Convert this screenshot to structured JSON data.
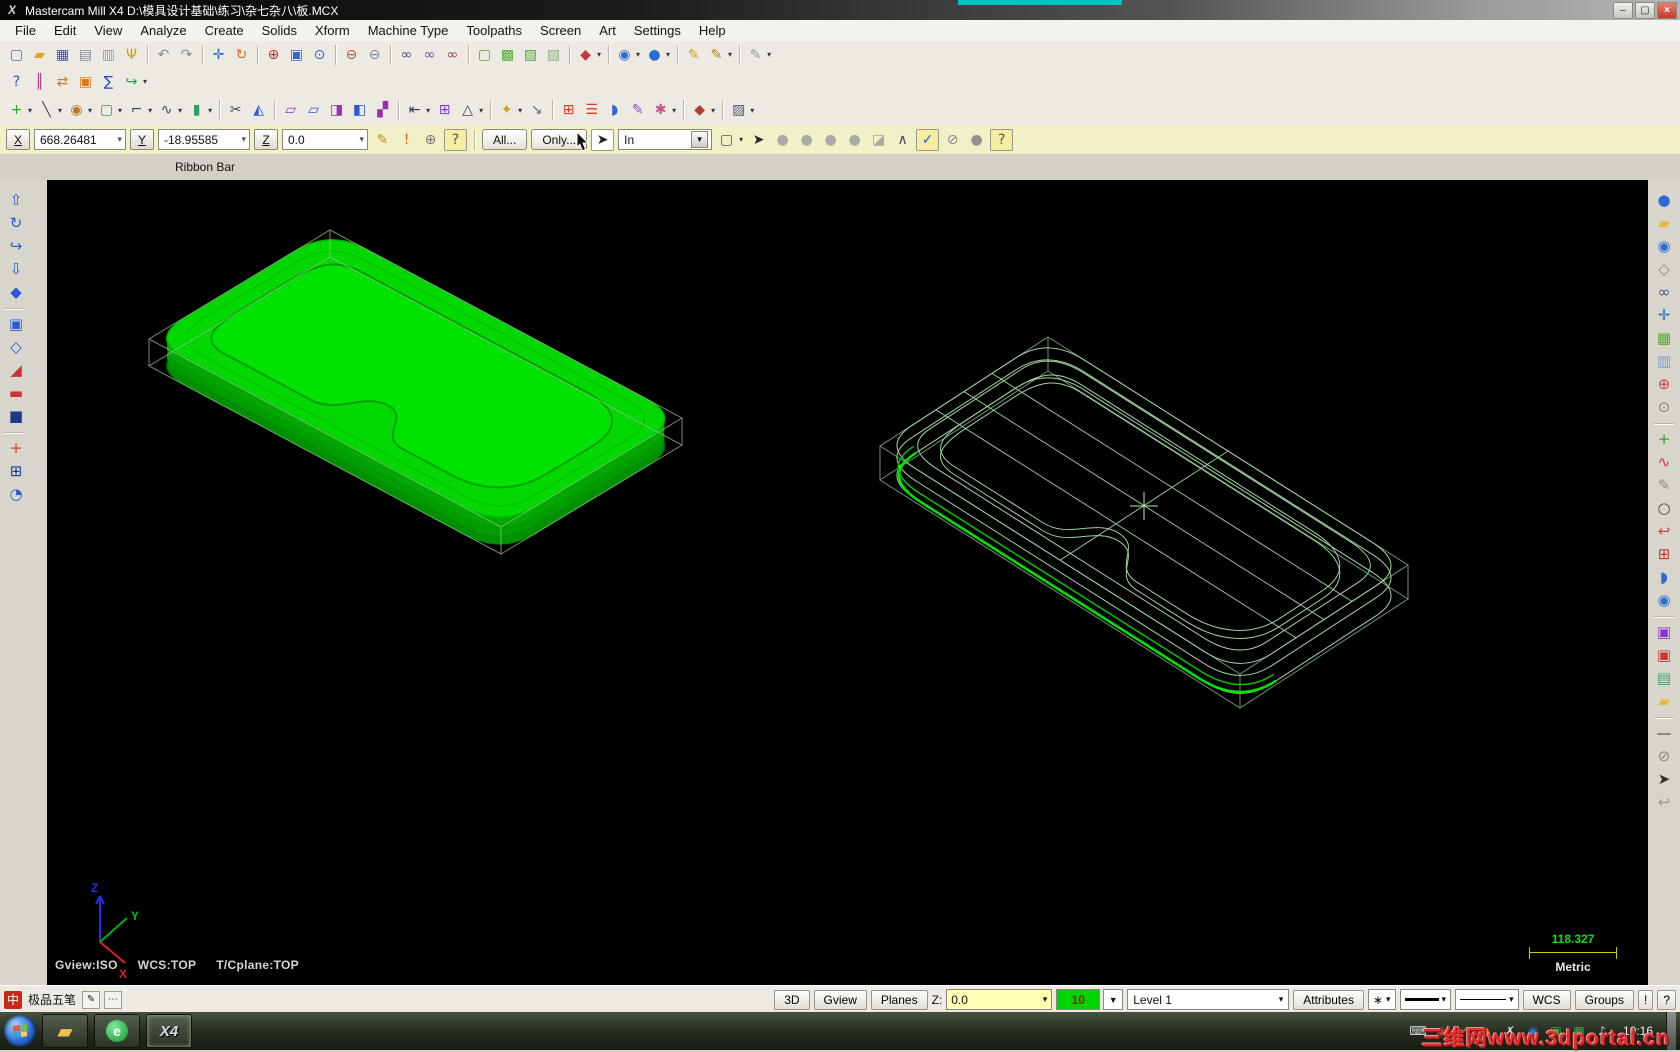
{
  "title_bar": {
    "app_icon_glyph": "X",
    "app_title": "Mastercam Mill X4  D:\\模具设计基础\\练习\\杂七杂八\\板.MCX",
    "minimize_glyph": "–",
    "restore_glyph": "▢",
    "close_glyph": "×"
  },
  "menu_bar": {
    "items": [
      {
        "label": "File"
      },
      {
        "label": "Edit"
      },
      {
        "label": "View"
      },
      {
        "label": "Analyze"
      },
      {
        "label": "Create"
      },
      {
        "label": "Solids"
      },
      {
        "label": "Xform"
      },
      {
        "label": "Machine Type"
      },
      {
        "label": "Toolpaths"
      },
      {
        "label": "Screen"
      },
      {
        "label": "Art"
      },
      {
        "label": "Settings"
      },
      {
        "label": "Help"
      }
    ]
  },
  "toolbar_row1": [
    {
      "n": "new-file",
      "g": "▢",
      "c": "#4a71c8"
    },
    {
      "n": "open-file",
      "g": "▰",
      "c": "#dca62e"
    },
    {
      "n": "save-file",
      "g": "▦",
      "c": "#2f55c0"
    },
    {
      "n": "print",
      "g": "▤",
      "c": "#8a8f9a"
    },
    {
      "n": "file-properties",
      "g": "▥",
      "c": "#7f9fd0"
    },
    {
      "n": "screen-grab",
      "g": "Ψ",
      "c": "#c8a020"
    },
    {
      "sep": true
    },
    {
      "n": "undo",
      "g": "↶",
      "c": "#8a8a8a"
    },
    {
      "n": "redo",
      "g": "↷",
      "c": "#8a8a8a"
    },
    {
      "sep": true
    },
    {
      "n": "pan",
      "g": "✛",
      "c": "#2b6bd4"
    },
    {
      "n": "dynamic-rotate",
      "g": "↻",
      "c": "#e06820"
    },
    {
      "sep": true
    },
    {
      "n": "zoom-target",
      "g": "⊕",
      "c": "#c03030"
    },
    {
      "n": "zoom-window",
      "g": "▣",
      "c": "#3366cc"
    },
    {
      "n": "zoom-selected",
      "g": "⊙",
      "c": "#3366cc"
    },
    {
      "sep": true
    },
    {
      "n": "zoom-out-80",
      "g": "⊖",
      "c": "#b06030"
    },
    {
      "n": "zoom-out",
      "g": "⊖",
      "c": "#7788aa"
    },
    {
      "sep": true
    },
    {
      "n": "fit-screen",
      "g": "∞",
      "c": "#445a8a"
    },
    {
      "n": "repaint",
      "g": "∞",
      "c": "#7755aa"
    },
    {
      "n": "clear-colors",
      "g": "∞",
      "c": "#aa4444"
    },
    {
      "sep": true
    },
    {
      "n": "shading-wireframe",
      "g": "▢",
      "c": "#58a832"
    },
    {
      "n": "shading-shaded",
      "g": "▩",
      "c": "#58a832"
    },
    {
      "n": "shading-translucent",
      "g": "▨",
      "c": "#58a832"
    },
    {
      "n": "shading-off",
      "g": "▧",
      "c": "#8ab07a"
    },
    {
      "sep": true
    },
    {
      "n": "delete-entities",
      "g": "◆",
      "c": "#cc3344",
      "caret": true
    },
    {
      "sep": true
    },
    {
      "n": "gview-select",
      "g": "◉",
      "c": "#2b6bd4",
      "caret": true
    },
    {
      "n": "cplane-select",
      "g": "●",
      "c": "#2b6bd4",
      "caret": true
    },
    {
      "sep": true
    },
    {
      "n": "set-attributes",
      "g": "✎",
      "c": "#d8a020"
    },
    {
      "n": "set-attributes-multi",
      "g": "✎",
      "c": "#b8860b",
      "caret": true
    },
    {
      "sep": true
    },
    {
      "n": "undelete",
      "g": "✎",
      "c": "#999999",
      "caret": true
    }
  ],
  "toolbar_row2": [
    {
      "n": "analyze-entity",
      "g": "?",
      "c": "#2b5bd4"
    },
    {
      "n": "analyze-distance",
      "g": "║",
      "c": "#b03090"
    },
    {
      "n": "analyze-dynamic",
      "g": "⇄",
      "c": "#e07820"
    },
    {
      "n": "analyze-area",
      "g": "▣",
      "c": "#e07820"
    },
    {
      "n": "analyze-volume",
      "g": "∑",
      "c": "#2244cc"
    },
    {
      "n": "analyze-chain",
      "g": "↪",
      "c": "#22a044",
      "caret": true
    }
  ],
  "toolbar_row3": [
    {
      "n": "create-point",
      "g": "+",
      "c": "#22aa22",
      "caret": true
    },
    {
      "n": "create-line",
      "g": "╲",
      "c": "#444455",
      "caret": true
    },
    {
      "n": "create-arc",
      "g": "◉",
      "c": "#b8772a",
      "caret": true
    },
    {
      "n": "create-rectangle",
      "g": "▢",
      "c": "#3aa03a",
      "caret": true
    },
    {
      "n": "create-fillet",
      "g": "⌐",
      "c": "#444455",
      "caret": true
    },
    {
      "n": "create-spline",
      "g": "∿",
      "c": "#444455",
      "caret": true
    },
    {
      "n": "create-primitives",
      "g": "▮",
      "c": "#2f9e5f",
      "caret": true
    },
    {
      "sep": true
    },
    {
      "n": "curve-cut",
      "g": "✂",
      "c": "#445"
    },
    {
      "n": "surface-trim",
      "g": "◭",
      "c": "#2b5bd4"
    },
    {
      "sep": true
    },
    {
      "n": "xform-translate",
      "g": "▱",
      "c": "#9a30b0"
    },
    {
      "n": "xform-copy",
      "g": "▱",
      "c": "#3355cc"
    },
    {
      "n": "xform-offset",
      "g": "◨",
      "c": "#9a30b0"
    },
    {
      "n": "xform-project",
      "g": "◧",
      "c": "#3355cc"
    },
    {
      "n": "xform-mirror",
      "g": "▞",
      "c": "#9a30b0"
    },
    {
      "sep": true
    },
    {
      "n": "xform-stretch",
      "g": "⇤",
      "c": "#333344",
      "caret": true
    },
    {
      "n": "xform-array",
      "g": "⊞",
      "c": "#7a3acc"
    },
    {
      "n": "xform-scale",
      "g": "△",
      "c": "#444455",
      "caret": true
    },
    {
      "sep": true
    },
    {
      "n": "screen-combine",
      "g": "✦",
      "c": "#c8a020",
      "caret": true
    },
    {
      "n": "screen-shrink",
      "g": "↘",
      "c": "#666677"
    },
    {
      "sep": true
    },
    {
      "n": "grid-settings",
      "g": "⊞",
      "c": "#d04020"
    },
    {
      "n": "multi-lines",
      "g": "☰",
      "c": "#d04020"
    },
    {
      "n": "surface-shape",
      "g": "◗",
      "c": "#3366cc"
    },
    {
      "n": "feather-tool",
      "g": "✎",
      "c": "#8855cc"
    },
    {
      "n": "render-flower",
      "g": "✱",
      "c": "#cc5588",
      "caret": true
    },
    {
      "sep": true
    },
    {
      "n": "solids-stamp",
      "g": "◆",
      "c": "#b04030",
      "caret": true
    },
    {
      "sep": true
    },
    {
      "n": "surface-hatch",
      "g": "▨",
      "c": "#555566",
      "caret": true
    }
  ],
  "ribbon": {
    "label": "Ribbon Bar",
    "x_label": "X",
    "x_value": "668.26481",
    "y_label": "Y",
    "y_value": "-18.95585",
    "z_label": "Z",
    "z_value": "0.0",
    "all_button": "All...",
    "only_button": "Only...",
    "in_value": "In",
    "icons_a": [
      {
        "n": "fast-point",
        "g": "✎",
        "c": "#b8952a"
      },
      {
        "n": "autocursor-override",
        "g": "!",
        "c": "#e06010"
      },
      {
        "n": "cursor-position",
        "g": "⊕",
        "c": "#777777"
      },
      {
        "n": "autocursor-help",
        "g": "?",
        "c": "#555555",
        "bg": true
      }
    ],
    "icons_b": [
      {
        "n": "selection-window",
        "g": "▢",
        "c": "#555566",
        "caret": true
      },
      {
        "n": "select-arrow",
        "g": "➤",
        "c": "#222222"
      },
      {
        "n": "select-filter-1",
        "g": "●",
        "c": "#a8a8a8"
      },
      {
        "n": "select-filter-2",
        "g": "●",
        "c": "#a8a8a8"
      },
      {
        "n": "select-filter-3",
        "g": "●",
        "c": "#a8a8a8"
      },
      {
        "n": "select-filter-4",
        "g": "●",
        "c": "#a8a8a8"
      },
      {
        "n": "select-filter-5",
        "g": "◪",
        "c": "#a8a8a8"
      },
      {
        "n": "select-expand",
        "g": "∧",
        "c": "#444455"
      },
      {
        "n": "select-validate",
        "g": "✓",
        "c": "#2b5bd4",
        "bg": true
      },
      {
        "n": "select-none",
        "g": "⊘",
        "c": "#888888"
      },
      {
        "n": "select-off",
        "g": "●",
        "c": "#909090"
      },
      {
        "n": "selection-help",
        "g": "?",
        "c": "#555555",
        "bg": true
      }
    ]
  },
  "left_toolbar": [
    {
      "n": "solids-extrude",
      "g": "⇧",
      "c": "#2b5bd4"
    },
    {
      "n": "solids-revolve",
      "g": "↻",
      "c": "#2b5bd4"
    },
    {
      "n": "solids-sweep",
      "g": "↪",
      "c": "#2b5bd4"
    },
    {
      "n": "solids-loft",
      "g": "⇩",
      "c": "#2b5bd4"
    },
    {
      "n": "solids-fillet",
      "g": "◆",
      "c": "#2b5bd4"
    },
    {
      "sep": true
    },
    {
      "n": "solids-shell",
      "g": "▣",
      "c": "#2b5bd4"
    },
    {
      "n": "solids-chamfer",
      "g": "◇",
      "c": "#2b5bd4"
    },
    {
      "n": "solids-draft",
      "g": "◢",
      "c": "#cc3333"
    },
    {
      "n": "solids-trim",
      "g": "▬",
      "c": "#cc3333"
    },
    {
      "n": "solids-thicken",
      "g": "■",
      "c": "#1a3a8a"
    },
    {
      "sep": true
    },
    {
      "n": "solids-boolean-add",
      "g": "+",
      "c": "#cc4422"
    },
    {
      "n": "solids-boolean-common",
      "g": "⊞",
      "c": "#1a3a8a"
    },
    {
      "n": "solids-history",
      "g": "◔",
      "c": "#2b5bd4"
    }
  ],
  "right_toolbar": [
    {
      "n": "gview-sphere",
      "g": "●",
      "c": "#2b6bd4"
    },
    {
      "n": "open-folder",
      "g": "▰",
      "c": "#e8b63c"
    },
    {
      "n": "gview-globe",
      "g": "◉",
      "c": "#2b6bd4"
    },
    {
      "n": "gview-cube",
      "g": "◇",
      "c": "#888888"
    },
    {
      "n": "view-binoculars",
      "g": "∞",
      "c": "#445a8a"
    },
    {
      "n": "view-pan",
      "g": "✛",
      "c": "#2b6bd4"
    },
    {
      "n": "view-cube-green",
      "g": "▦",
      "c": "#58a832"
    },
    {
      "n": "copy-entities",
      "g": "▥",
      "c": "#7f9fd0"
    },
    {
      "n": "zoom-plus",
      "g": "⊕",
      "c": "#cc4444"
    },
    {
      "n": "zoom-settings",
      "g": "⊙",
      "c": "#888888"
    },
    {
      "sep": true
    },
    {
      "n": "create-plus",
      "g": "+",
      "c": "#22aa22"
    },
    {
      "n": "create-curve",
      "g": "∿",
      "c": "#cc3344"
    },
    {
      "n": "create-pencil",
      "g": "✎",
      "c": "#888888"
    },
    {
      "n": "create-circle",
      "g": "○",
      "c": "#444444"
    },
    {
      "n": "create-polyline",
      "g": "↩",
      "c": "#cc4444"
    },
    {
      "n": "grid-red",
      "g": "⊞",
      "c": "#cc3322"
    },
    {
      "n": "surface-blue",
      "g": "◗",
      "c": "#3366cc"
    },
    {
      "n": "globe-2",
      "g": "◉",
      "c": "#2b6bd4"
    },
    {
      "sep": true
    },
    {
      "n": "attributes-purple",
      "g": "▣",
      "c": "#8833cc"
    },
    {
      "n": "attributes-red",
      "g": "▣",
      "c": "#cc3333"
    },
    {
      "n": "palette",
      "g": "▤",
      "c": "#33aa66"
    },
    {
      "n": "folder-yellow",
      "g": "▰",
      "c": "#e8b63c"
    },
    {
      "sep": true
    },
    {
      "n": "ruler-line",
      "g": "—",
      "c": "#444444"
    },
    {
      "n": "no-entry",
      "g": "⊘",
      "c": "#888888"
    },
    {
      "n": "cursor-spark",
      "g": "➤",
      "c": "#333333"
    },
    {
      "n": "back-arrow",
      "g": "↩",
      "c": "#999999"
    }
  ],
  "viewport": {
    "gview": "Gview:ISO",
    "wcs": "WCS:TOP",
    "tcplane": "T/Cplane:TOP",
    "scale_value": "118.327",
    "units": "Metric",
    "axis_x": "X",
    "axis_y": "Y",
    "axis_z": "Z",
    "solid_color": "#00d800",
    "wireframe_color": "#a0d4a0",
    "highlight_color": "#00e400"
  },
  "status_bar": {
    "ime_flag": "中",
    "ime_name": "极品五笔",
    "ime_pen_glyph": "✎",
    "ime_more_glyph": "⋯",
    "btn_3d": "3D",
    "btn_gview": "Gview",
    "btn_planes": "Planes",
    "z_label": "Z:",
    "z_value": "0.0",
    "color_value": "10",
    "color_drop_glyph": "▼",
    "level_value": "Level 1",
    "btn_attributes": "Attributes",
    "point_style_glyph": "∗",
    "btn_wcs": "WCS",
    "btn_groups": "Groups",
    "btn_warn": "!",
    "btn_help": "?"
  },
  "taskbar": {
    "explorer_glyph": "▰",
    "browser_glyph": "e",
    "x4_label": "X4",
    "clock": "10:16",
    "watermark": "三维网www.3dportal.cn",
    "tray_icons": [
      {
        "n": "tray-keyboard",
        "g": "⌨",
        "c": "#e0e0e0"
      },
      {
        "n": "tray-magnifier",
        "g": "◉",
        "c": "#d04040"
      },
      {
        "n": "tray-antivirus",
        "g": "✔",
        "c": "#30a030"
      },
      {
        "n": "tray-alert",
        "g": "▲",
        "c": "#e08020"
      },
      {
        "n": "tray-x-tool",
        "g": "✗",
        "c": "#e0e0e0"
      },
      {
        "n": "tray-network",
        "g": "◉",
        "c": "#3377cc"
      },
      {
        "n": "tray-camera",
        "g": "▣",
        "c": "#55aa44"
      },
      {
        "n": "tray-green-app",
        "g": "▦",
        "c": "#44aa44"
      },
      {
        "n": "tray-volume",
        "g": "♪",
        "c": "#e0e0e0"
      }
    ]
  }
}
